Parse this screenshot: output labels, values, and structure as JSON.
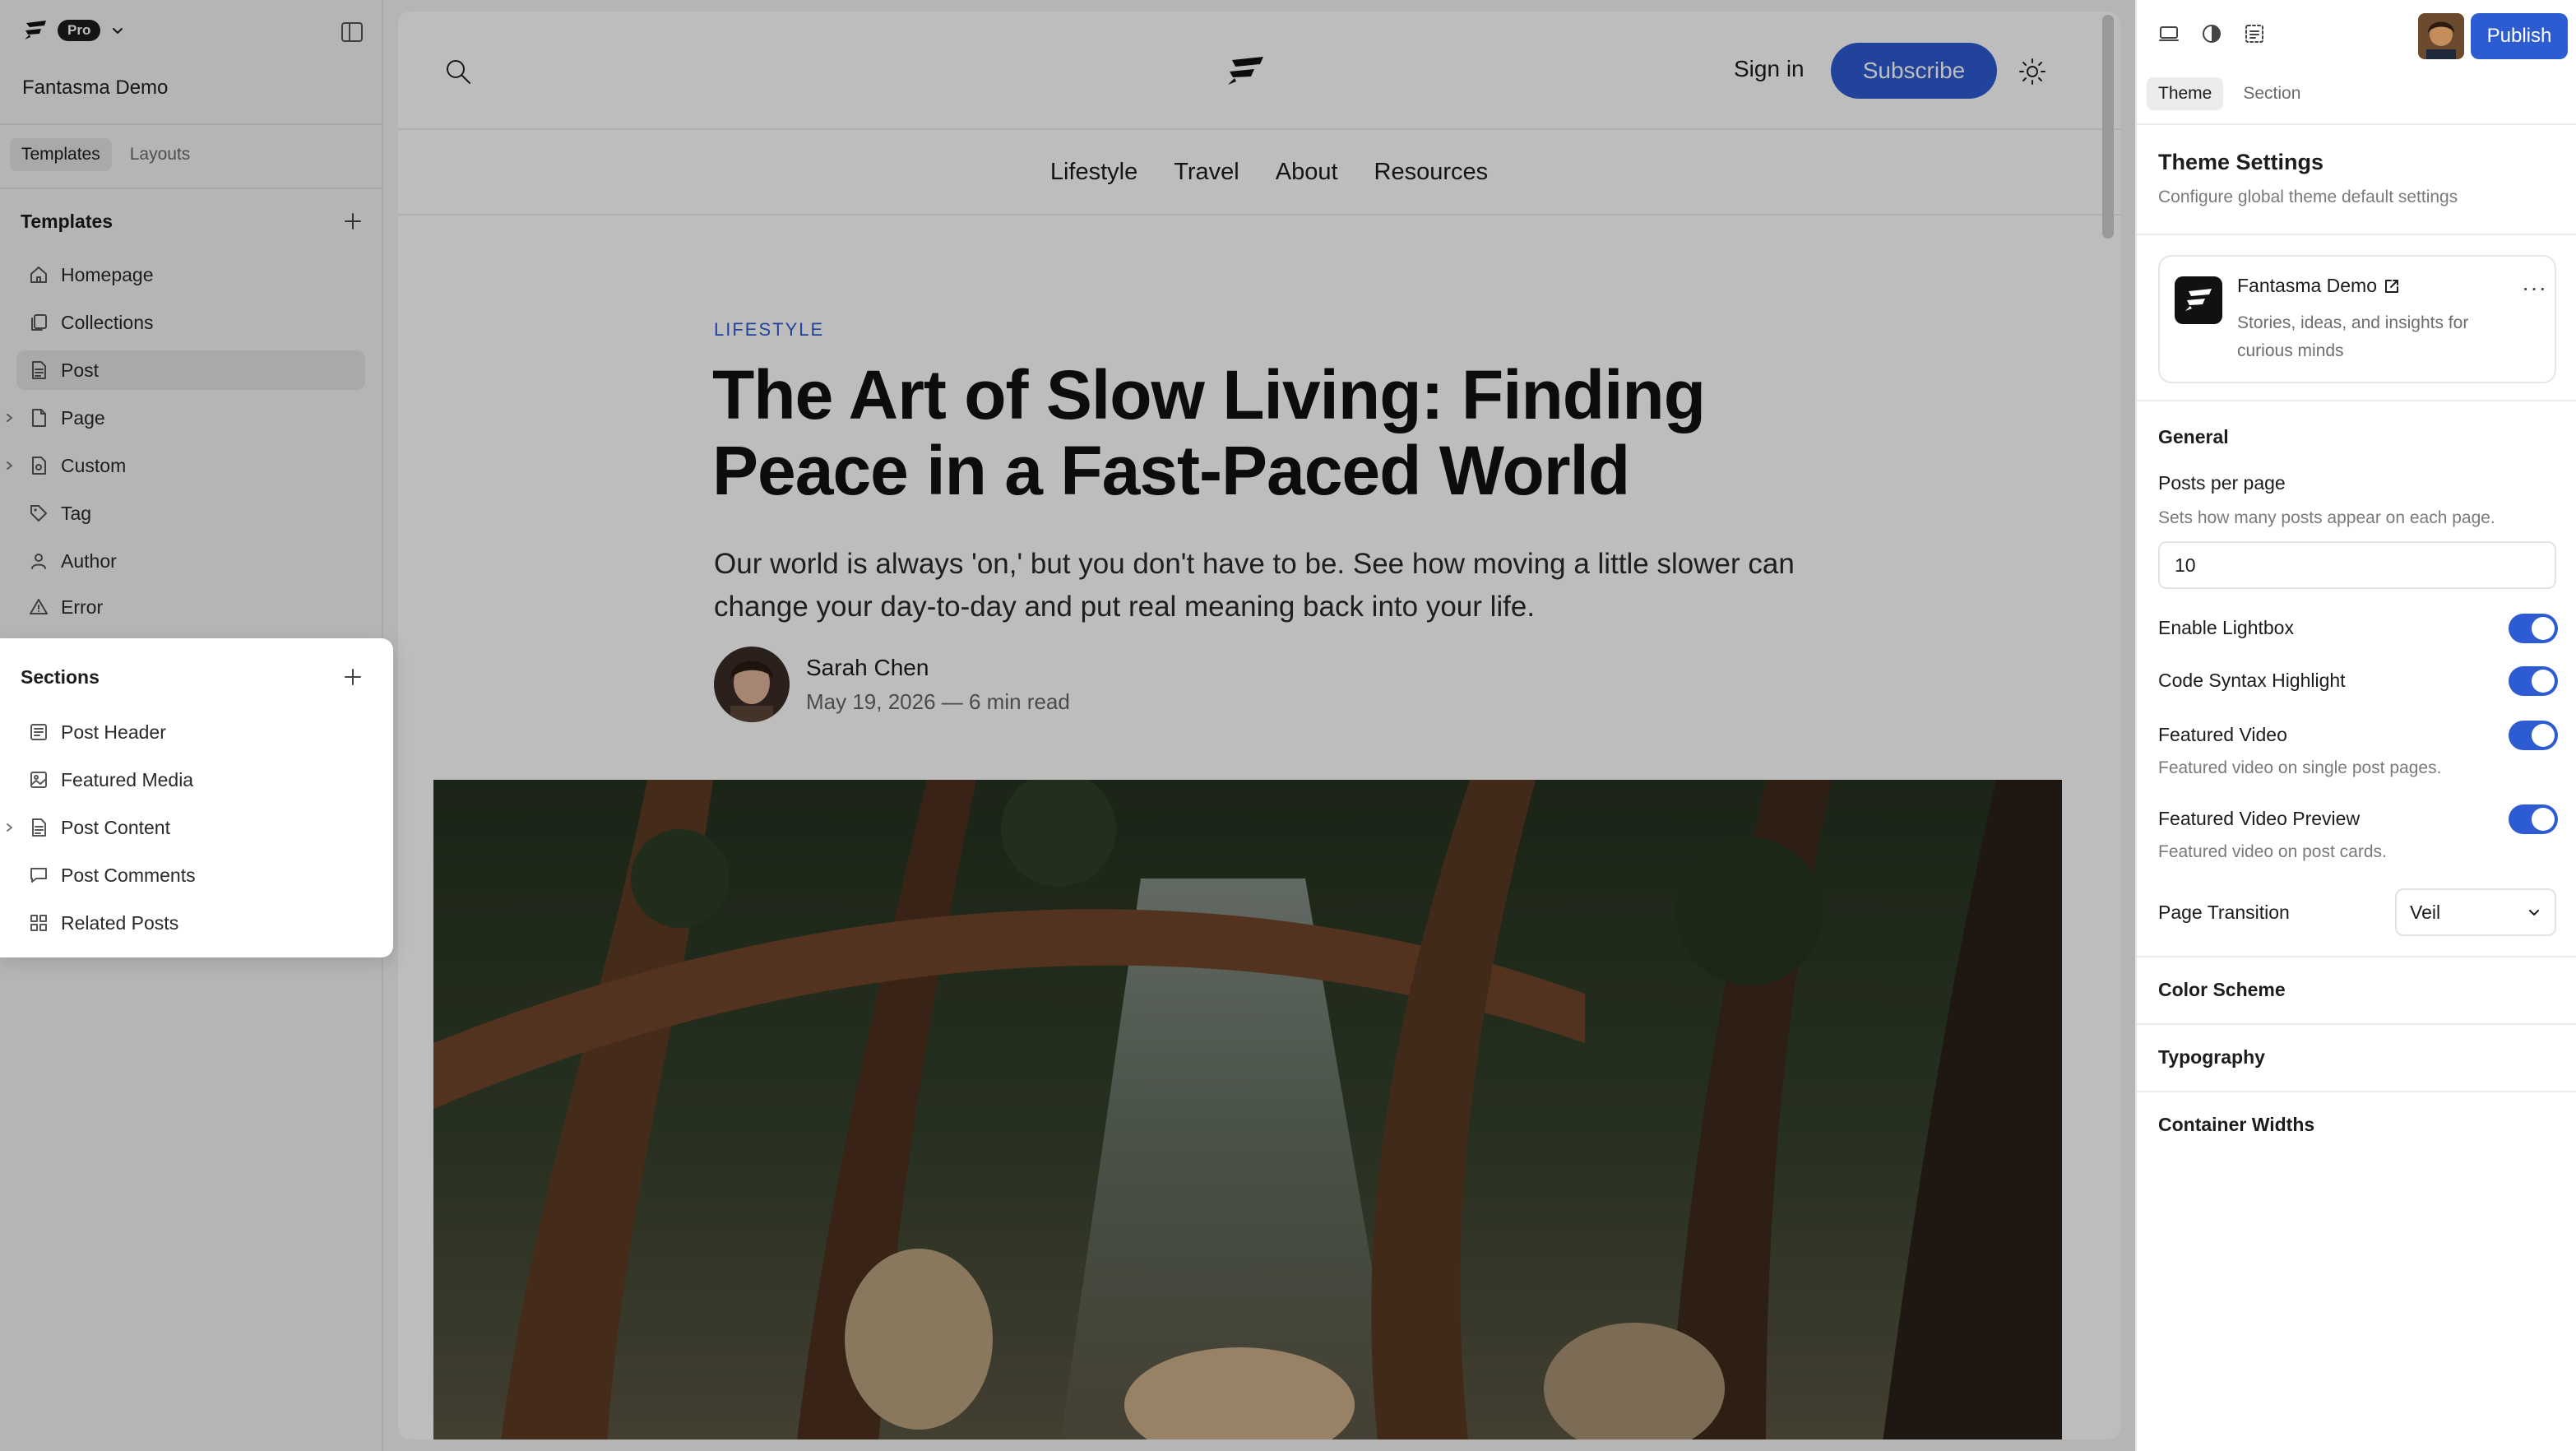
{
  "app": {
    "plan_badge": "Pro",
    "site_name": "Fantasma Demo"
  },
  "left_tabs": [
    "Templates",
    "Layouts"
  ],
  "templates": {
    "title": "Templates",
    "items": [
      {
        "label": "Homepage",
        "icon": "home-icon"
      },
      {
        "label": "Collections",
        "icon": "collections-icon"
      },
      {
        "label": "Post",
        "icon": "document-icon",
        "selected": true
      },
      {
        "label": "Page",
        "icon": "page-icon",
        "expandable": true
      },
      {
        "label": "Custom",
        "icon": "custom-icon",
        "expandable": true
      },
      {
        "label": "Tag",
        "icon": "tag-icon"
      },
      {
        "label": "Author",
        "icon": "user-icon"
      },
      {
        "label": "Error",
        "icon": "warning-icon"
      }
    ]
  },
  "sections": {
    "title": "Sections",
    "items": [
      {
        "label": "Post Header",
        "icon": "header-icon"
      },
      {
        "label": "Featured Media",
        "icon": "image-icon"
      },
      {
        "label": "Post Content",
        "icon": "document-icon",
        "expandable": true
      },
      {
        "label": "Post Comments",
        "icon": "comment-icon"
      },
      {
        "label": "Related Posts",
        "icon": "grid-icon"
      }
    ]
  },
  "preview": {
    "header": {
      "signin": "Sign in",
      "subscribe": "Subscribe"
    },
    "nav": [
      "Lifestyle",
      "Travel",
      "About",
      "Resources"
    ],
    "post": {
      "tag": "LIFESTYLE",
      "title": "The Art of Slow Living: Finding Peace in a Fast-Paced World",
      "excerpt": "Our world is always 'on,' but you don't have to be. See how moving a little slower can change your day-to-day and put real meaning back into your life.",
      "author": "Sarah Chen",
      "meta": "May 19, 2026 — 6 min read"
    }
  },
  "right": {
    "publish": "Publish",
    "tabs": [
      "Theme",
      "Section"
    ],
    "heading": "Theme Settings",
    "subheading": "Configure global theme default settings",
    "site_card": {
      "name": "Fantasma Demo",
      "description": "Stories, ideas, and insights for curious minds"
    },
    "general_title": "General",
    "posts_per_page": {
      "label": "Posts per page",
      "help": "Sets how many posts appear on each page.",
      "value": "10"
    },
    "toggles": [
      {
        "label": "Enable Lightbox",
        "on": true
      },
      {
        "label": "Code Syntax Highlight",
        "on": true
      },
      {
        "label": "Featured Video",
        "help": "Featured video on single post pages.",
        "on": true
      },
      {
        "label": "Featured Video Preview",
        "help": "Featured video on post cards.",
        "on": true
      }
    ],
    "page_transition": {
      "label": "Page Transition",
      "value": "Veil"
    },
    "collapsed_sections": [
      "Color Scheme",
      "Typography",
      "Container Widths"
    ]
  },
  "colors": {
    "accent": "#2d5bd1",
    "overlay": "rgba(0,0,0,0.26)"
  }
}
